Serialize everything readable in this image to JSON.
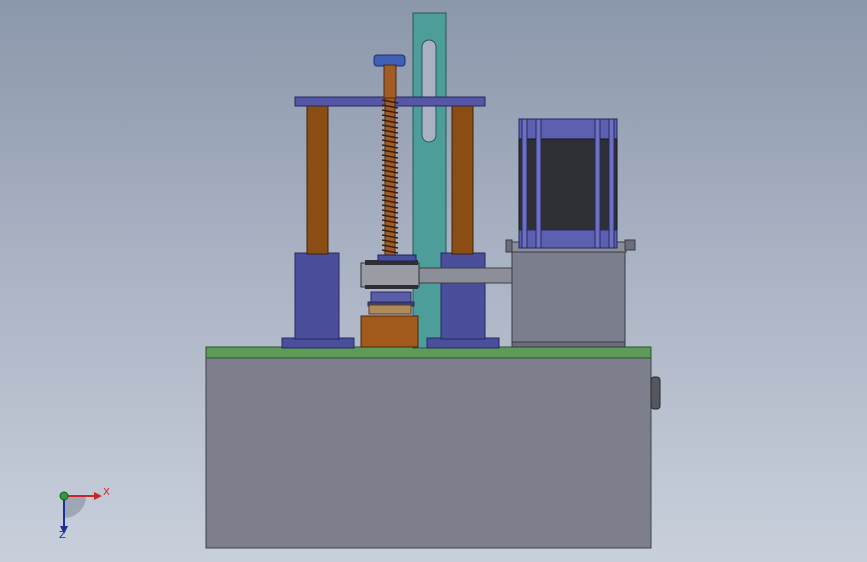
{
  "view": {
    "type": "cad-3d-viewport",
    "background_top": "#8b97ab",
    "background_bottom": "#c9d0dc"
  },
  "triad": {
    "x_label": "X",
    "z_label": "Z",
    "x_color": "#c8262a",
    "y_color": "#2a9d3a",
    "z_color": "#1f2f9a"
  },
  "model": {
    "base_color": "#7d7f8d",
    "top_plate_color": "#5e9b58",
    "guide_rail_color": "#4d9e9b",
    "rod_color": "#8a4d14",
    "support_color": "#4b4e9b",
    "motor_color": "#5d5fb0",
    "motor_body_color": "#2f2f36",
    "screw_color": "#a25c24",
    "mount_color": "#7b7f8d"
  }
}
